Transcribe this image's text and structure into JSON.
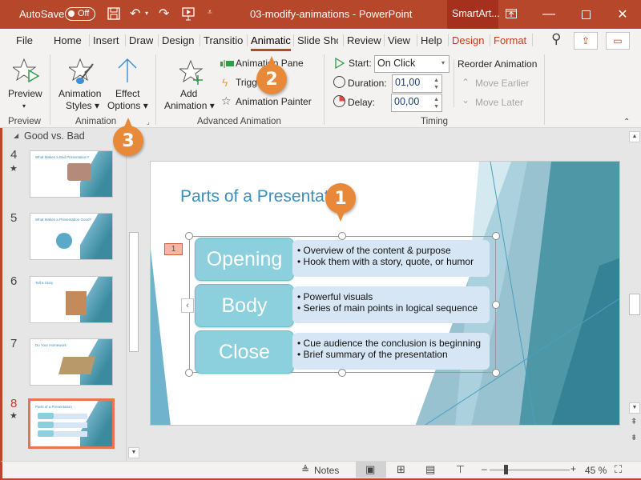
{
  "titlebar": {
    "autosave_label": "AutoSave",
    "autosave_state": "Off",
    "doc_title": "03-modify-animations - PowerPoint",
    "context_tab": "SmartArt...",
    "icons": [
      "save-icon",
      "undo-icon",
      "redo-icon",
      "present-icon",
      "customize-qat-icon",
      "ribbon-display-icon",
      "minimize-icon",
      "maximize-icon",
      "close-icon"
    ]
  },
  "tabs": {
    "items": [
      "File",
      "Home",
      "Insert",
      "Draw",
      "Design",
      "Transitio",
      "Animatic",
      "Slide Shc",
      "Review",
      "View",
      "Help"
    ],
    "active": "Animatic",
    "context_items": [
      "Design",
      "Format"
    ]
  },
  "ribbon": {
    "preview": {
      "button": "Preview",
      "group": "Preview"
    },
    "animation": {
      "styles": "Animation",
      "styles2": "Styles",
      "effect": "Effect",
      "effect2": "Options",
      "group": "Animation"
    },
    "advanced": {
      "add": "Add",
      "add2": "Animation",
      "pane": "Animation Pane",
      "trigger": "Trigger",
      "painter": "Animation Painter",
      "group": "Advanced Animation"
    },
    "timing": {
      "start_label": "Start:",
      "start_value": "On Click",
      "duration_label": "Duration:",
      "duration_value": "01,00",
      "delay_label": "Delay:",
      "delay_value": "00,00",
      "group": "Timing"
    },
    "reorder": {
      "title": "Reorder Animation",
      "earlier": "Move Earlier",
      "later": "Move Later"
    }
  },
  "slides_pane": {
    "section": "Good vs. Bad",
    "slides": [
      {
        "num": "4",
        "title": "What Makes a Bad Presentation?",
        "star": true
      },
      {
        "num": "5",
        "title": "What Makes a Presentation Good?",
        "star": false
      },
      {
        "num": "6",
        "title": "Tell a Story",
        "star": false
      },
      {
        "num": "7",
        "title": "Do Your Homework",
        "star": false
      },
      {
        "num": "8",
        "title": "Parts of a Presentation",
        "star": true,
        "selected": true
      }
    ]
  },
  "slide": {
    "title": "Parts of a Presentation",
    "animation_tag": "1",
    "rows": [
      {
        "label": "Opening",
        "bullets": [
          "Overview of the content & purpose",
          "Hook them with a story, quote, or humor"
        ]
      },
      {
        "label": "Body",
        "bullets": [
          "Powerful visuals",
          "Series of main points in logical sequence"
        ]
      },
      {
        "label": "Close",
        "bullets": [
          "Cue audience the conclusion is beginning",
          "Brief summary of the presentation"
        ]
      }
    ]
  },
  "statusbar": {
    "notes": "Notes",
    "zoom": "45 %",
    "zoom_level_percent": 45
  },
  "callouts": [
    "1",
    "2",
    "3"
  ],
  "colors": {
    "accent": "#b7472a",
    "callout": "#e8893a",
    "slide_title": "#3a8fbe",
    "smartart": "#8ccfdd"
  }
}
